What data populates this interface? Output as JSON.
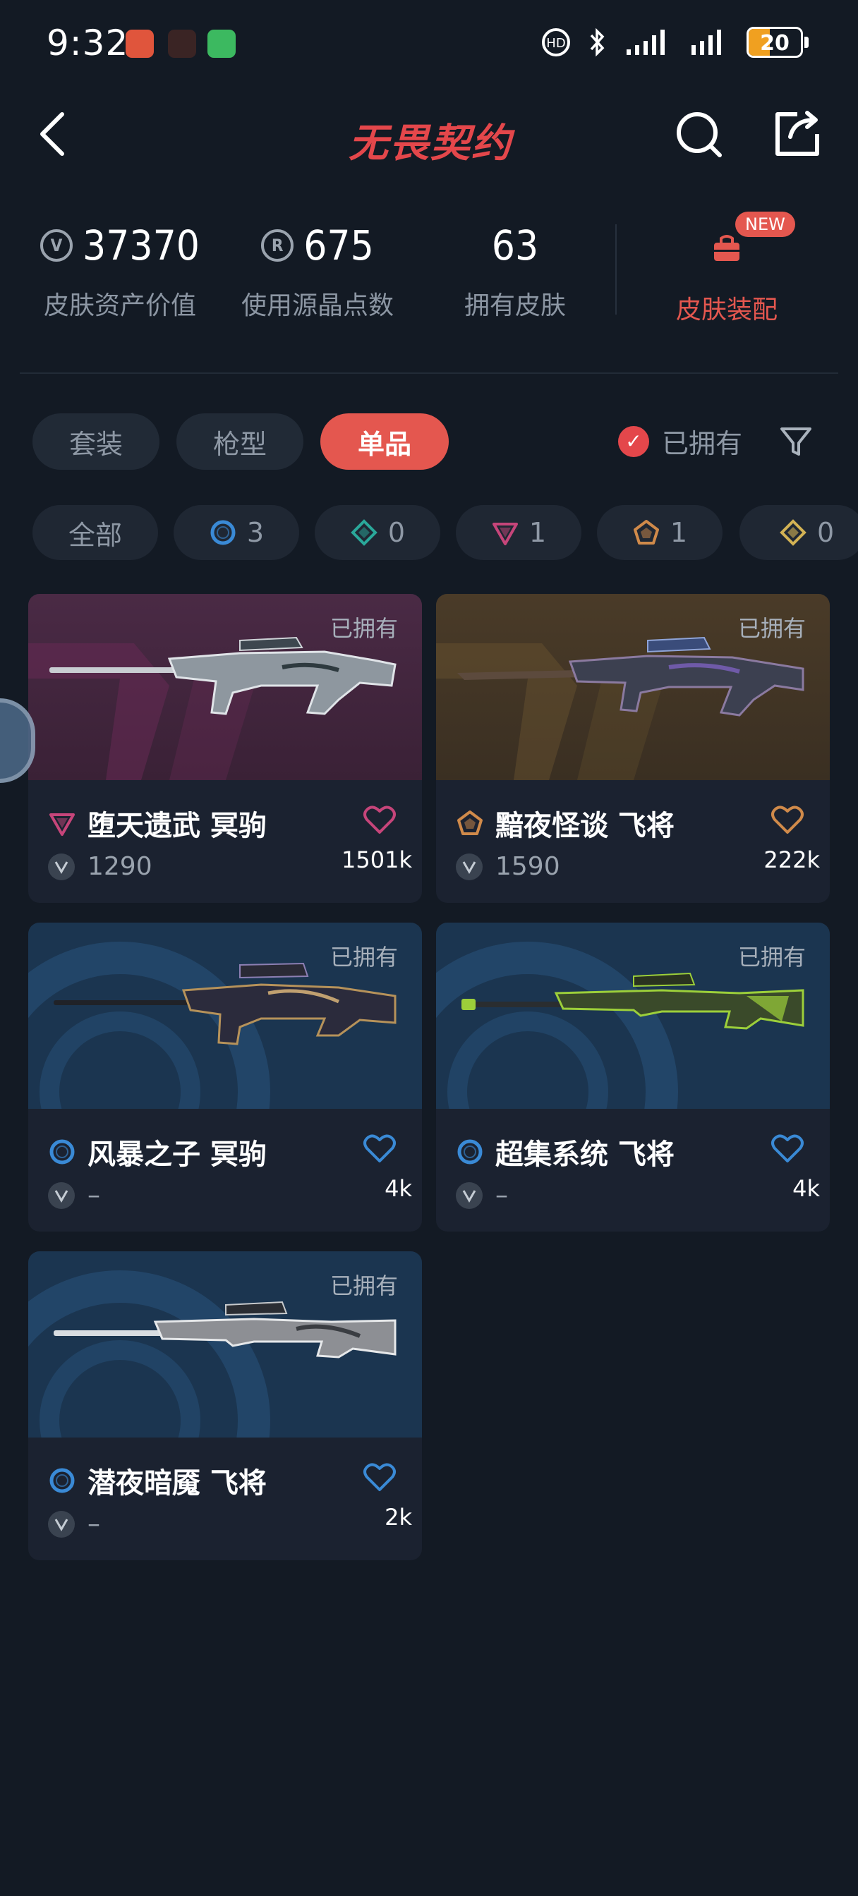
{
  "status_bar": {
    "time": "9:32",
    "battery": "20",
    "battery_level": 0.2,
    "icons": [
      "notification-icon",
      "game-app-icon",
      "wechat-icon",
      "hd-call-icon",
      "bluetooth-icon",
      "signal-icon",
      "signal-icon",
      "battery-icon"
    ]
  },
  "header": {
    "title": "无畏契约",
    "icons": [
      "back-icon",
      "search-icon",
      "share-icon"
    ]
  },
  "stats": [
    {
      "value": "37370",
      "label": "皮肤资产价值",
      "icon": "vp-icon"
    },
    {
      "value": "675",
      "label": "使用源晶点数",
      "icon": "radianite-icon"
    },
    {
      "value": "63",
      "label": "拥有皮肤"
    }
  ],
  "equip": {
    "badge": "NEW",
    "label": "皮肤装配",
    "icon": "wardrobe-icon"
  },
  "tabs": [
    {
      "label": "套装",
      "active": false
    },
    {
      "label": "枪型",
      "active": false
    },
    {
      "label": "单品",
      "active": true
    }
  ],
  "owned_filter": {
    "label": "已拥有",
    "checked": true
  },
  "rarity_chips": [
    {
      "label": "全部"
    },
    {
      "count": "3",
      "icon": "select-tier-icon",
      "color": "#3a8ad6"
    },
    {
      "count": "0",
      "icon": "deluxe-tier-icon",
      "color": "#2aa89a"
    },
    {
      "count": "1",
      "icon": "premium-tier-icon",
      "color": "#c6457a"
    },
    {
      "count": "1",
      "icon": "exclusive-tier-icon",
      "color": "#d08a4a"
    },
    {
      "count": "0",
      "icon": "ultra-tier-icon",
      "color": "#d2b254"
    }
  ],
  "skins": [
    {
      "name": "堕天遗武 冥驹",
      "price": "1290",
      "likes": "1501k",
      "owned": "已拥有",
      "tier": "premium",
      "tier_color": "#c6457a",
      "heart_color": "#c6457a",
      "bg": "#3d2638"
    },
    {
      "name": "黯夜怪谈 飞将",
      "price": "1590",
      "likes": "222k",
      "owned": "已拥有",
      "tier": "exclusive",
      "tier_color": "#d08a4a",
      "heart_color": "#d08a4a",
      "bg": "#3a3124"
    },
    {
      "name": "风暴之子 冥驹",
      "price": "–",
      "likes": "4k",
      "owned": "已拥有",
      "tier": "select",
      "tier_color": "#3a8ad6",
      "heart_color": "#3a8ad6",
      "bg": "#1b3550"
    },
    {
      "name": "超集系统 飞将",
      "price": "–",
      "likes": "4k",
      "owned": "已拥有",
      "tier": "select",
      "tier_color": "#3a8ad6",
      "heart_color": "#3a8ad6",
      "bg": "#1b3550"
    },
    {
      "name": "潜夜暗魇 飞将",
      "price": "–",
      "likes": "2k",
      "owned": "已拥有",
      "tier": "select",
      "tier_color": "#3a8ad6",
      "heart_color": "#3a8ad6",
      "bg": "#1b3550"
    }
  ]
}
